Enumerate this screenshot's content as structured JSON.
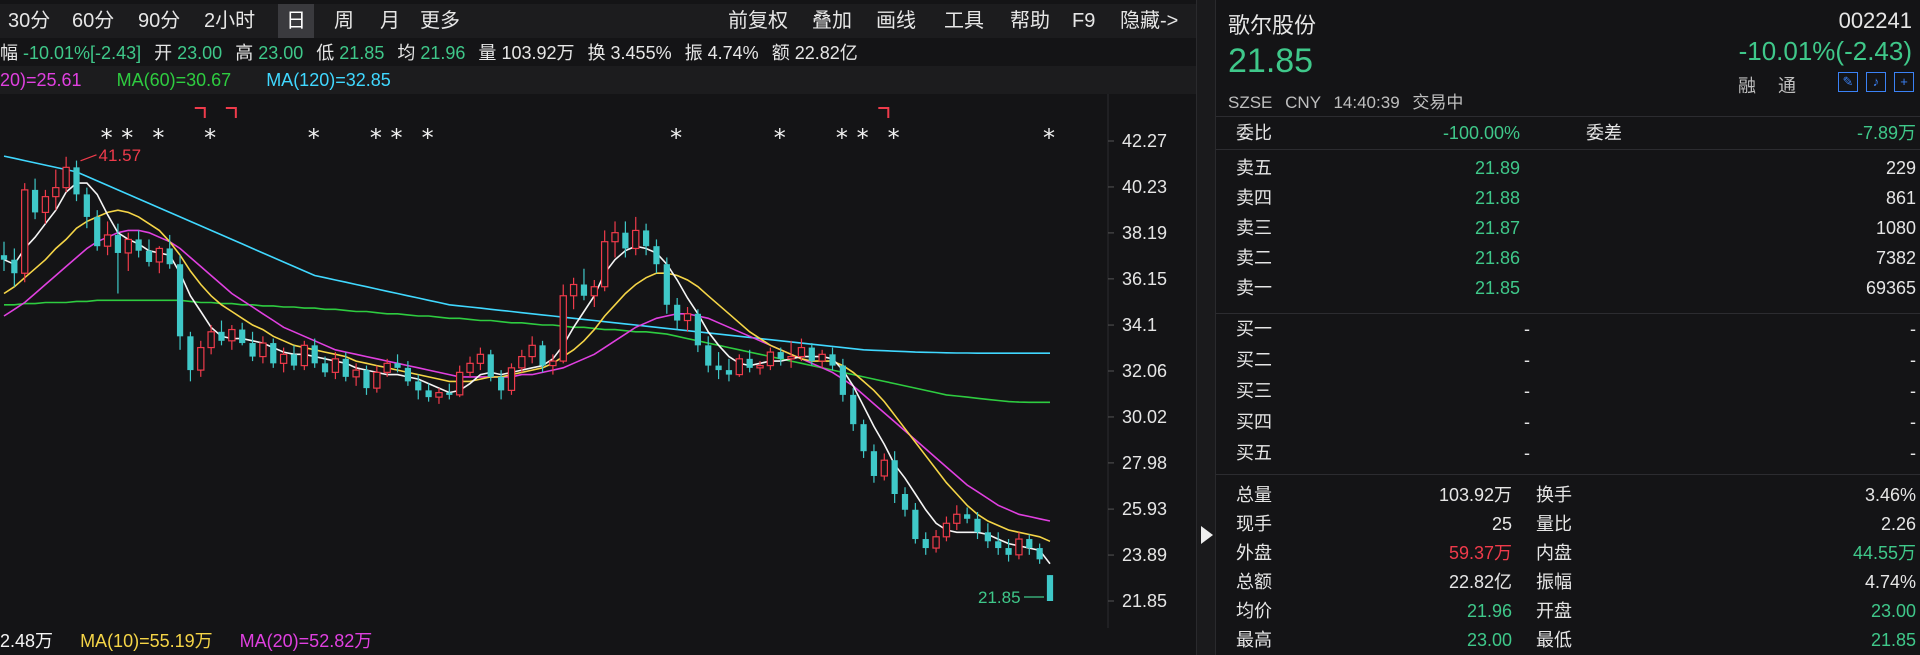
{
  "toolbar": {
    "left": [
      "30分",
      "60分",
      "90分",
      "2小时",
      "日",
      "周",
      "月",
      "更多"
    ],
    "active": "日",
    "right": [
      "前复权",
      "叠加",
      "画线",
      "工具",
      "帮助",
      "F9",
      "隐藏->"
    ]
  },
  "quote_line": {
    "change_label": "幅",
    "change_value": "-10.01%[-2.43]",
    "open_label": "开",
    "open_value": "23.00",
    "high_label": "高",
    "high_value": "23.00",
    "low_label": "低",
    "low_value": "21.85",
    "avg_label": "均",
    "avg_value": "21.96",
    "vol_label": "量",
    "vol_value": "103.92万",
    "turn_label": "换",
    "turn_value": "3.455%",
    "amp_label": "振",
    "amp_value": "4.74%",
    "amt_label": "额",
    "amt_value": "22.82亿"
  },
  "ma_line": {
    "ma20": "20)=25.61",
    "ma60": "MA(60)=30.67",
    "ma120": "MA(120)=32.85"
  },
  "vol_line": {
    "ma5": "2.48万",
    "ma10": "MA(10)=55.19万",
    "ma20": "MA(20)=52.82万"
  },
  "colors": {
    "up": "#ef3b4b",
    "down": "#3fc8c8",
    "ma5": "#f5f5f5",
    "ma10": "#f5d547",
    "ma20": "#e040e0",
    "ma60": "#2ecc40",
    "ma120": "#40d8ff",
    "green_text": "#3fc88a",
    "red_text": "#ef3b4b"
  },
  "chart_data": {
    "type": "candlestick",
    "y_ticks": [
      "42.27",
      "40.23",
      "38.19",
      "36.15",
      "34.1",
      "32.06",
      "30.02",
      "27.98",
      "25.93",
      "23.89",
      "21.85"
    ],
    "ylim": [
      21.85,
      42.27
    ],
    "markers": [
      {
        "label": "41.57",
        "value": 41.57,
        "bar": 7
      },
      {
        "label": "21.85",
        "value": 21.85,
        "bar": 101
      }
    ],
    "stars_at": [
      10,
      12,
      15,
      20,
      30,
      36,
      38,
      41,
      65,
      75,
      81,
      83,
      86,
      101
    ],
    "flags_at": [
      19,
      22,
      85
    ],
    "candles": [
      [
        37.2,
        37.8,
        36.5,
        37.0
      ],
      [
        37.0,
        37.5,
        35.8,
        36.4
      ],
      [
        36.4,
        40.4,
        36.0,
        40.1
      ],
      [
        40.1,
        40.6,
        38.8,
        39.1
      ],
      [
        39.1,
        40.1,
        38.6,
        39.8
      ],
      [
        39.8,
        41.0,
        39.2,
        40.2
      ],
      [
        40.2,
        41.57,
        40.0,
        41.1
      ],
      [
        41.1,
        41.4,
        39.6,
        39.9
      ],
      [
        39.9,
        40.2,
        38.4,
        38.9
      ],
      [
        38.9,
        39.2,
        37.4,
        37.6
      ],
      [
        37.6,
        38.7,
        37.2,
        38.1
      ],
      [
        38.1,
        38.6,
        35.5,
        37.3
      ],
      [
        37.3,
        38.2,
        36.5,
        37.9
      ],
      [
        37.9,
        38.3,
        37.1,
        37.4
      ],
      [
        37.4,
        37.9,
        36.7,
        36.9
      ],
      [
        36.9,
        37.6,
        36.4,
        37.5
      ],
      [
        37.5,
        38.1,
        36.6,
        36.8
      ],
      [
        36.8,
        37.2,
        33.0,
        33.6
      ],
      [
        33.6,
        33.8,
        31.6,
        32.1
      ],
      [
        32.1,
        33.4,
        31.8,
        33.1
      ],
      [
        33.1,
        34.1,
        32.8,
        33.8
      ],
      [
        33.8,
        34.3,
        33.2,
        33.4
      ],
      [
        33.4,
        34.1,
        33.0,
        33.9
      ],
      [
        33.9,
        34.2,
        33.2,
        33.3
      ],
      [
        33.3,
        33.8,
        32.5,
        32.7
      ],
      [
        32.7,
        33.6,
        32.4,
        33.3
      ],
      [
        33.3,
        33.5,
        32.2,
        32.4
      ],
      [
        32.4,
        33.1,
        32.0,
        32.8
      ],
      [
        32.8,
        33.2,
        32.1,
        32.3
      ],
      [
        32.3,
        33.4,
        32.1,
        33.2
      ],
      [
        33.2,
        33.5,
        32.2,
        32.4
      ],
      [
        32.4,
        32.7,
        31.8,
        32.0
      ],
      [
        32.0,
        32.9,
        31.7,
        32.6
      ],
      [
        32.6,
        32.9,
        31.6,
        31.8
      ],
      [
        31.8,
        32.4,
        31.4,
        32.1
      ],
      [
        32.1,
        32.3,
        31.0,
        31.3
      ],
      [
        31.3,
        32.3,
        31.1,
        32.0
      ],
      [
        32.0,
        32.6,
        31.8,
        32.4
      ],
      [
        32.4,
        32.8,
        32.0,
        32.2
      ],
      [
        32.2,
        32.5,
        31.4,
        31.6
      ],
      [
        31.6,
        31.9,
        30.8,
        31.2
      ],
      [
        31.2,
        31.5,
        30.7,
        30.9
      ],
      [
        30.9,
        31.3,
        30.6,
        31.1
      ],
      [
        31.1,
        31.5,
        30.8,
        31.0
      ],
      [
        31.0,
        32.3,
        30.9,
        32.0
      ],
      [
        32.0,
        32.7,
        31.8,
        32.4
      ],
      [
        32.4,
        33.1,
        32.1,
        32.8
      ],
      [
        32.8,
        33.0,
        31.6,
        31.8
      ],
      [
        31.8,
        32.1,
        30.8,
        31.2
      ],
      [
        31.2,
        32.4,
        31.0,
        32.2
      ],
      [
        32.2,
        33.0,
        32.0,
        32.7
      ],
      [
        32.7,
        33.6,
        32.4,
        33.2
      ],
      [
        33.2,
        33.4,
        32.0,
        32.3
      ],
      [
        32.3,
        32.8,
        31.9,
        32.5
      ],
      [
        32.5,
        35.9,
        32.4,
        35.4
      ],
      [
        35.4,
        36.2,
        34.8,
        35.9
      ],
      [
        35.9,
        36.6,
        35.2,
        35.4
      ],
      [
        35.4,
        36.1,
        34.9,
        35.8
      ],
      [
        35.8,
        38.3,
        35.6,
        37.8
      ],
      [
        37.8,
        38.7,
        37.1,
        38.2
      ],
      [
        38.2,
        38.7,
        37.1,
        37.5
      ],
      [
        37.5,
        38.9,
        37.2,
        38.3
      ],
      [
        38.3,
        38.6,
        37.2,
        37.6
      ],
      [
        37.6,
        37.9,
        36.4,
        36.8
      ],
      [
        36.8,
        37.1,
        34.6,
        35.0
      ],
      [
        35.0,
        35.3,
        33.9,
        34.3
      ],
      [
        34.3,
        34.9,
        33.8,
        34.6
      ],
      [
        34.6,
        34.8,
        32.9,
        33.2
      ],
      [
        33.2,
        33.6,
        32.0,
        32.3
      ],
      [
        32.3,
        32.9,
        31.7,
        32.1
      ],
      [
        32.1,
        32.6,
        31.6,
        31.9
      ],
      [
        31.9,
        32.8,
        31.8,
        32.6
      ],
      [
        32.6,
        33.0,
        32.0,
        32.2
      ],
      [
        32.2,
        32.5,
        31.9,
        32.3
      ],
      [
        32.3,
        33.1,
        32.1,
        32.9
      ],
      [
        32.9,
        33.1,
        32.3,
        32.6
      ],
      [
        32.6,
        33.4,
        32.2,
        32.7
      ],
      [
        32.7,
        33.5,
        32.5,
        33.1
      ],
      [
        33.1,
        33.3,
        32.3,
        32.5
      ],
      [
        32.5,
        33.0,
        32.2,
        32.8
      ],
      [
        32.8,
        33.1,
        32.1,
        32.3
      ],
      [
        32.3,
        32.6,
        30.7,
        31.0
      ],
      [
        31.0,
        31.3,
        29.4,
        29.7
      ],
      [
        29.7,
        29.9,
        28.2,
        28.5
      ],
      [
        28.5,
        28.8,
        27.1,
        27.4
      ],
      [
        27.4,
        28.4,
        27.2,
        28.1
      ],
      [
        28.1,
        28.5,
        26.2,
        26.6
      ],
      [
        26.6,
        26.9,
        25.6,
        25.9
      ],
      [
        25.9,
        26.2,
        24.4,
        24.6
      ],
      [
        24.6,
        24.9,
        23.9,
        24.2
      ],
      [
        24.2,
        25.0,
        24.0,
        24.7
      ],
      [
        24.7,
        25.6,
        24.5,
        25.3
      ],
      [
        25.3,
        26.1,
        25.0,
        25.7
      ],
      [
        25.7,
        26.0,
        25.3,
        25.5
      ],
      [
        25.5,
        25.8,
        24.6,
        24.9
      ],
      [
        24.9,
        25.3,
        24.2,
        24.5
      ],
      [
        24.5,
        24.9,
        23.9,
        24.2
      ],
      [
        24.2,
        24.6,
        23.6,
        23.9
      ],
      [
        23.9,
        24.9,
        23.7,
        24.6
      ],
      [
        24.6,
        24.8,
        23.9,
        24.2
      ],
      [
        24.2,
        24.4,
        23.5,
        23.7
      ],
      [
        23.0,
        23.0,
        21.85,
        21.85
      ]
    ],
    "ma5": [
      37.0,
      36.8,
      37.5,
      38.0,
      38.6,
      39.2,
      40.0,
      40.4,
      40.4,
      39.9,
      39.0,
      38.2,
      37.9,
      37.7,
      37.4,
      37.3,
      37.2,
      36.4,
      35.4,
      34.7,
      34.0,
      33.6,
      33.5,
      33.5,
      33.4,
      33.3,
      33.1,
      32.9,
      32.8,
      32.8,
      32.7,
      32.6,
      32.5,
      32.4,
      32.2,
      32.1,
      32.0,
      31.9,
      31.9,
      31.8,
      31.7,
      31.5,
      31.3,
      31.1,
      31.2,
      31.5,
      31.9,
      32.0,
      31.9,
      32.0,
      32.1,
      32.2,
      32.3,
      32.6,
      33.2,
      34.0,
      34.7,
      35.4,
      36.4,
      37.0,
      37.4,
      37.6,
      37.5,
      37.3,
      36.8,
      36.1,
      35.3,
      34.6,
      33.8,
      33.2,
      32.7,
      32.4,
      32.3,
      32.4,
      32.5,
      32.5,
      32.6,
      32.7,
      32.7,
      32.7,
      32.6,
      32.1,
      31.4,
      30.5,
      29.6,
      28.8,
      27.9,
      27.3,
      26.6,
      25.9,
      25.3,
      25.0,
      24.9,
      24.9,
      24.9,
      24.8,
      24.6,
      24.4,
      24.3,
      24.2,
      24.1,
      23.5
    ],
    "ma10": [
      35.5,
      35.8,
      36.2,
      36.6,
      37.0,
      37.5,
      37.9,
      38.4,
      38.7,
      38.9,
      39.1,
      39.2,
      39.1,
      38.9,
      38.6,
      38.3,
      37.8,
      37.2,
      36.5,
      35.9,
      35.4,
      35.0,
      34.7,
      34.4,
      34.1,
      33.9,
      33.6,
      33.4,
      33.2,
      33.1,
      33.0,
      32.9,
      32.8,
      32.7,
      32.5,
      32.4,
      32.3,
      32.2,
      32.1,
      32.0,
      31.9,
      31.8,
      31.7,
      31.6,
      31.6,
      31.6,
      31.7,
      31.8,
      31.8,
      31.9,
      32.0,
      32.1,
      32.2,
      32.4,
      32.7,
      33.0,
      33.4,
      33.9,
      34.5,
      35.0,
      35.5,
      35.9,
      36.2,
      36.4,
      36.4,
      36.3,
      36.1,
      35.8,
      35.4,
      35.0,
      34.6,
      34.2,
      33.8,
      33.5,
      33.2,
      33.0,
      32.8,
      32.6,
      32.5,
      32.5,
      32.5,
      32.3,
      32.0,
      31.6,
      31.2,
      30.7,
      30.1,
      29.5,
      28.9,
      28.3,
      27.7,
      27.1,
      26.6,
      26.1,
      25.7,
      25.4,
      25.2,
      25.0,
      24.9,
      24.8,
      24.7,
      24.5
    ],
    "ma20": [
      34.5,
      34.8,
      35.1,
      35.5,
      35.9,
      36.3,
      36.7,
      37.1,
      37.5,
      37.8,
      38.0,
      38.2,
      38.3,
      38.3,
      38.2,
      38.0,
      37.8,
      37.5,
      37.1,
      36.7,
      36.3,
      35.9,
      35.5,
      35.2,
      34.9,
      34.6,
      34.3,
      34.0,
      33.8,
      33.6,
      33.4,
      33.2,
      33.0,
      32.9,
      32.8,
      32.7,
      32.6,
      32.5,
      32.4,
      32.3,
      32.2,
      32.1,
      32.0,
      31.9,
      31.8,
      31.8,
      31.8,
      31.8,
      31.8,
      31.8,
      31.9,
      31.9,
      32.0,
      32.1,
      32.2,
      32.4,
      32.6,
      32.8,
      33.1,
      33.4,
      33.7,
      34.0,
      34.2,
      34.4,
      34.5,
      34.6,
      34.6,
      34.5,
      34.4,
      34.2,
      34.0,
      33.8,
      33.6,
      33.4,
      33.2,
      33.0,
      32.8,
      32.6,
      32.4,
      32.2,
      32.0,
      31.7,
      31.4,
      31.0,
      30.6,
      30.2,
      29.8,
      29.4,
      29.0,
      28.6,
      28.2,
      27.8,
      27.4,
      27.0,
      26.7,
      26.4,
      26.1,
      25.9,
      25.7,
      25.6,
      25.5,
      25.4
    ],
    "ma60": [
      35.0,
      35.0,
      35.05,
      35.05,
      35.1,
      35.1,
      35.1,
      35.15,
      35.15,
      35.2,
      35.2,
      35.2,
      35.2,
      35.2,
      35.2,
      35.2,
      35.2,
      35.2,
      35.15,
      35.1,
      35.1,
      35.05,
      35.05,
      35.0,
      35.0,
      34.95,
      34.95,
      34.9,
      34.9,
      34.85,
      34.85,
      34.8,
      34.8,
      34.75,
      34.7,
      34.7,
      34.65,
      34.6,
      34.6,
      34.55,
      34.5,
      34.5,
      34.45,
      34.4,
      34.4,
      34.35,
      34.3,
      34.3,
      34.25,
      34.2,
      34.2,
      34.15,
      34.1,
      34.1,
      34.05,
      34.0,
      34.0,
      33.95,
      33.9,
      33.9,
      33.85,
      33.8,
      33.8,
      33.75,
      33.7,
      33.6,
      33.5,
      33.4,
      33.3,
      33.2,
      33.1,
      33.0,
      32.9,
      32.8,
      32.7,
      32.6,
      32.5,
      32.4,
      32.3,
      32.2,
      32.1,
      32.0,
      31.9,
      31.8,
      31.7,
      31.6,
      31.5,
      31.4,
      31.3,
      31.2,
      31.1,
      31.0,
      30.95,
      30.9,
      30.85,
      30.8,
      30.75,
      30.7,
      30.68,
      30.67,
      30.67,
      30.67
    ],
    "ma120": [
      41.6,
      41.5,
      41.4,
      41.3,
      41.2,
      41.1,
      41.0,
      40.9,
      40.7,
      40.5,
      40.3,
      40.1,
      39.9,
      39.7,
      39.5,
      39.3,
      39.1,
      38.9,
      38.7,
      38.5,
      38.3,
      38.1,
      37.9,
      37.7,
      37.5,
      37.3,
      37.1,
      36.9,
      36.7,
      36.5,
      36.3,
      36.2,
      36.1,
      36.0,
      35.9,
      35.8,
      35.7,
      35.6,
      35.5,
      35.4,
      35.3,
      35.2,
      35.1,
      35.0,
      34.95,
      34.9,
      34.85,
      34.8,
      34.75,
      34.7,
      34.65,
      34.6,
      34.55,
      34.5,
      34.45,
      34.4,
      34.35,
      34.3,
      34.25,
      34.2,
      34.15,
      34.1,
      34.05,
      34.0,
      33.95,
      33.9,
      33.85,
      33.8,
      33.75,
      33.7,
      33.65,
      33.6,
      33.55,
      33.5,
      33.45,
      33.4,
      33.35,
      33.3,
      33.25,
      33.2,
      33.15,
      33.1,
      33.05,
      33.0,
      32.98,
      32.96,
      32.94,
      32.92,
      32.9,
      32.89,
      32.88,
      32.87,
      32.86,
      32.86,
      32.85,
      32.85,
      32.85,
      32.85,
      32.85,
      32.85,
      32.85,
      32.85
    ]
  },
  "panel": {
    "name": "歌尔股份",
    "code": "002241",
    "price": "21.85",
    "change": "-10.01%(-2.43)",
    "exchange": "SZSE",
    "currency": "CNY",
    "time": "14:40:39",
    "status": "交易中",
    "rong": "融",
    "tong": "通",
    "weibi_label": "委比",
    "weibi_value": "-100.00%",
    "weicha_label": "委差",
    "weicha_value": "-7.89万",
    "asks": [
      {
        "label": "卖五",
        "price": "21.89",
        "vol": "229"
      },
      {
        "label": "卖四",
        "price": "21.88",
        "vol": "861"
      },
      {
        "label": "卖三",
        "price": "21.87",
        "vol": "1080"
      },
      {
        "label": "卖二",
        "price": "21.86",
        "vol": "7382"
      },
      {
        "label": "卖一",
        "price": "21.85",
        "vol": "69365"
      }
    ],
    "bids": [
      {
        "label": "买一",
        "price": "-",
        "vol": "-"
      },
      {
        "label": "买二",
        "price": "-",
        "vol": "-"
      },
      {
        "label": "买三",
        "price": "-",
        "vol": "-"
      },
      {
        "label": "买四",
        "price": "-",
        "vol": "-"
      },
      {
        "label": "买五",
        "price": "-",
        "vol": "-"
      }
    ],
    "stats": [
      {
        "l1": "总量",
        "v1": "103.92万",
        "c1": "w",
        "l2": "换手",
        "v2": "3.46%",
        "c2": "w"
      },
      {
        "l1": "现手",
        "v1": "25",
        "c1": "w",
        "l2": "量比",
        "v2": "2.26",
        "c2": "w"
      },
      {
        "l1": "外盘",
        "v1": "59.37万",
        "c1": "r",
        "l2": "内盘",
        "v2": "44.55万",
        "c2": "g"
      },
      {
        "l1": "总额",
        "v1": "22.82亿",
        "c1": "w",
        "l2": "振幅",
        "v2": "4.74%",
        "c2": "w"
      },
      {
        "l1": "均价",
        "v1": "21.96",
        "c1": "g",
        "l2": "开盘",
        "v2": "23.00",
        "c2": "g"
      },
      {
        "l1": "最高",
        "v1": "23.00",
        "c1": "g",
        "l2": "最低",
        "v2": "21.85",
        "c2": "g"
      }
    ]
  }
}
